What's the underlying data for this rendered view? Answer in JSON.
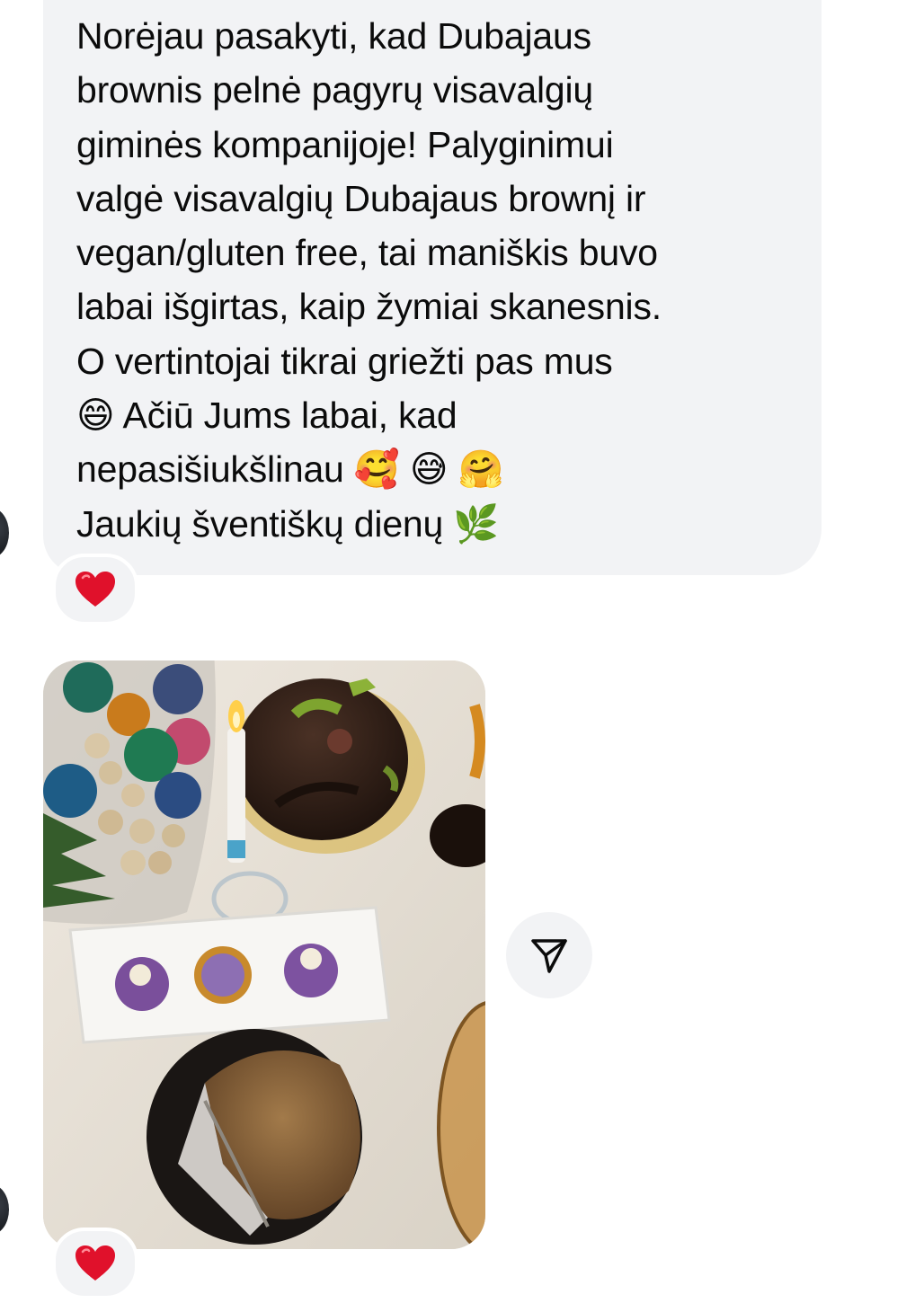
{
  "message": {
    "lines": [
      "Norėjau pasakyti, kad Dubajaus",
      "brownis pelnė pagyrų visavalgių",
      "giminės kompanijoje! Palyginimui",
      "valgė visavalgių Dubajaus brownį ir",
      "vegan/gluten free, tai maniškis buvo",
      "labai išgirtas, kaip žymiai skanesnis.",
      "O vertintojai tikrai griežti pas mus",
      "Ačiū Jums labai, kad",
      "nepasišiukšlinau",
      "Jaukių šventiškų dienų"
    ],
    "emojis": {
      "grin": "😄",
      "smiling_hearts": "🥰",
      "sweat_smile": "😅",
      "hug": "🤗",
      "herb": "🌿"
    },
    "reaction": "heart"
  },
  "photo_message": {
    "description_icon": "dessert-table-photo",
    "reaction": "heart"
  },
  "share_button": {
    "icon": "paper-plane-icon"
  },
  "colors": {
    "bubble_bg": "#f2f3f5",
    "heart": "#e0112b",
    "text": "#0b0b0b"
  }
}
